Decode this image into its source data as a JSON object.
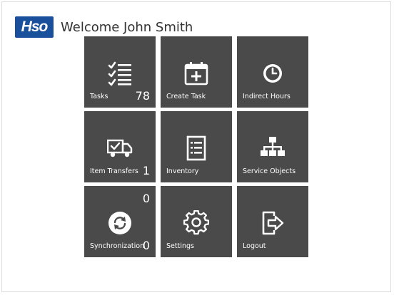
{
  "header": {
    "logo_text": "Hso",
    "welcome_text": "Welcome John Smith"
  },
  "tiles": [
    {
      "label": "Tasks",
      "icon": "checklist-icon",
      "count": "78"
    },
    {
      "label": "Create Task",
      "icon": "calendar-add-icon"
    },
    {
      "label": "Indirect Hours",
      "icon": "clock-icon"
    },
    {
      "label": "Item Transfers",
      "icon": "delivery-truck-icon",
      "count": "1"
    },
    {
      "label": "Inventory",
      "icon": "document-list-icon"
    },
    {
      "label": "Service Objects",
      "icon": "hierarchy-icon"
    },
    {
      "label": "Synchronization",
      "icon": "sync-icon",
      "count_top": "0",
      "count": "0"
    },
    {
      "label": "Settings",
      "icon": "gear-icon"
    },
    {
      "label": "Logout",
      "icon": "logout-icon"
    }
  ],
  "colors": {
    "tile_background": "#4a4a4a",
    "logo_background": "#1a4f9c",
    "page_background": "#ffffff"
  }
}
